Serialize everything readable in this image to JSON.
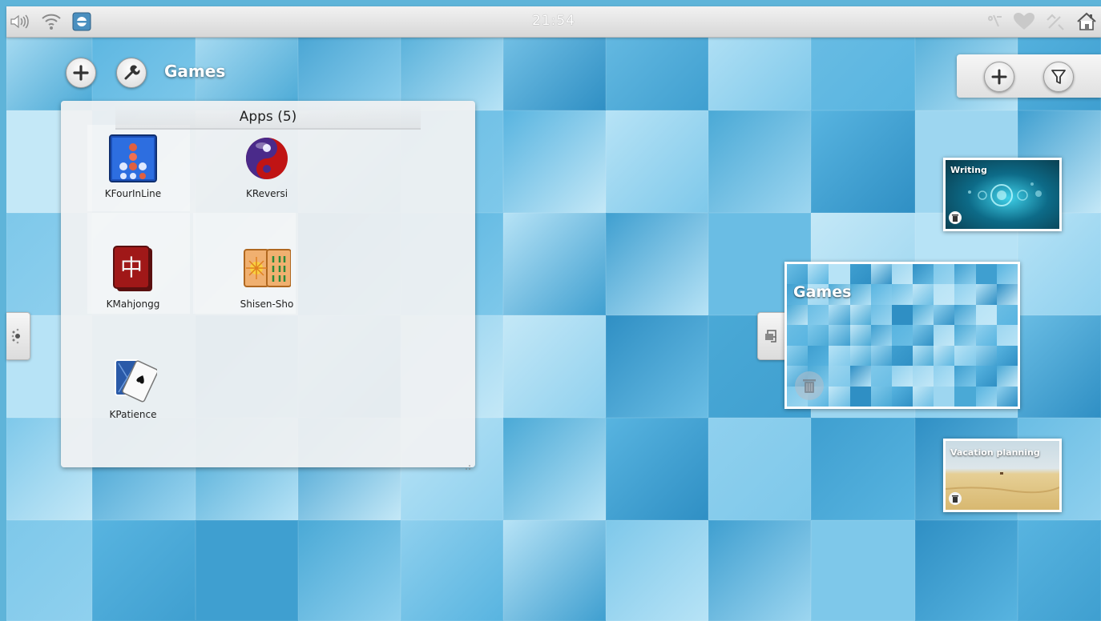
{
  "status_bar": {
    "clock": "21:54",
    "left_icons": [
      "volume-icon",
      "wifi-icon",
      "network-manager-icon"
    ],
    "right_icons": [
      "notifications-icon",
      "favorite-heart-icon",
      "tools-icon",
      "home-icon"
    ]
  },
  "activity": {
    "name": "Games",
    "add_button": "add-icon",
    "config_button": "wrench-icon"
  },
  "folder": {
    "title": "Apps (5)",
    "apps": [
      {
        "label": "KFourInLine",
        "icon": "kfourinline-icon"
      },
      {
        "label": "KReversi",
        "icon": "kreversi-icon"
      },
      {
        "label": "KMahjongg",
        "icon": "kmahjongg-icon"
      },
      {
        "label": "Shisen-Sho",
        "icon": "shisen-sho-icon"
      },
      {
        "label": "KPatience",
        "icon": "kpatience-icon"
      }
    ]
  },
  "activities_panel": {
    "add_icon": "add-icon",
    "filter_icon": "filter-icon",
    "items": [
      {
        "title": "Writing"
      },
      {
        "title": "Games"
      },
      {
        "title": "Vacation planning"
      }
    ]
  },
  "colors": {
    "wallpaper": "#5fb4d9",
    "accent_white": "#ffffff"
  }
}
